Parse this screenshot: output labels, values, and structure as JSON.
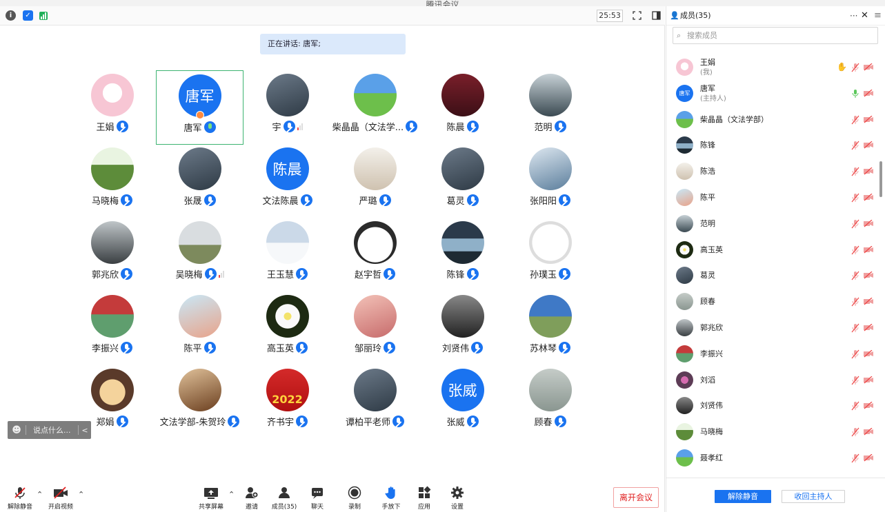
{
  "window": {
    "title": "腾讯会议"
  },
  "topbar": {
    "timer": "25:53",
    "icons": [
      "info-icon",
      "shield-icon",
      "signal-icon",
      "fullscreen-icon",
      "layout-icon"
    ]
  },
  "speaking": {
    "text": "正在讲话: 唐军;"
  },
  "grid": {
    "participants": [
      {
        "name": "王娟",
        "avatar": "anime-girl",
        "mic": "muted",
        "bars": 0
      },
      {
        "name": "唐军",
        "avatar_text": "唐军",
        "mic": "active",
        "bars": 0,
        "active": true
      },
      {
        "name": "宇",
        "avatar": "photo",
        "mic": "muted",
        "bars": 3
      },
      {
        "name": "柴晶晶（文法学...",
        "avatar": "landscape",
        "mic": "muted",
        "bars": 0
      },
      {
        "name": "陈晨",
        "avatar": "rabbits",
        "mic": "muted",
        "bars": 0
      },
      {
        "name": "范明",
        "avatar": "swan",
        "mic": "muted",
        "bars": 0
      },
      {
        "name": "马晓梅",
        "avatar": "sprout",
        "mic": "muted",
        "bars": 0
      },
      {
        "name": "张晟",
        "avatar": "photo",
        "mic": "muted",
        "bars": 0
      },
      {
        "name": "文法陈晨",
        "avatar_text": "陈晨",
        "mic": "muted",
        "bars": 0
      },
      {
        "name": "严璐",
        "avatar": "cartoon",
        "mic": "muted",
        "bars": 0
      },
      {
        "name": "葛灵",
        "avatar": "photo",
        "mic": "muted",
        "bars": 0
      },
      {
        "name": "张阳阳",
        "avatar": "sky",
        "mic": "muted",
        "bars": 0
      },
      {
        "name": "郭兆欣",
        "avatar": "dark-figure",
        "mic": "muted",
        "bars": 0
      },
      {
        "name": "吴晓梅",
        "avatar": "windmill",
        "mic": "muted",
        "bars": 3
      },
      {
        "name": "王玉慧",
        "avatar": "snow",
        "mic": "muted",
        "bars": 0
      },
      {
        "name": "赵宇哲",
        "avatar": "dog",
        "mic": "muted",
        "bars": 0
      },
      {
        "name": "陈锋",
        "avatar": "lake",
        "mic": "muted",
        "bars": 0
      },
      {
        "name": "孙璞玉",
        "avatar": "sketch",
        "mic": "muted",
        "bars": 0
      },
      {
        "name": "李振兴",
        "avatar": "court",
        "mic": "muted",
        "bars": 0
      },
      {
        "name": "陈平",
        "avatar": "dancer",
        "mic": "muted",
        "bars": 0
      },
      {
        "name": "高玉英",
        "avatar": "daisy",
        "mic": "muted",
        "bars": 0
      },
      {
        "name": "邹丽玲",
        "avatar": "woman",
        "mic": "muted",
        "bars": 0
      },
      {
        "name": "刘贤伟",
        "avatar": "bw-photo",
        "mic": "muted",
        "bars": 0
      },
      {
        "name": "苏林琴",
        "avatar": "sky-tree",
        "mic": "muted",
        "bars": 0
      },
      {
        "name": "郑娟",
        "avatar": "cartoon-girl",
        "mic": "muted",
        "bars": 0
      },
      {
        "name": "文法学部-朱贺玲",
        "avatar": "dog-fur",
        "mic": "muted",
        "bars": 0
      },
      {
        "name": "齐书宇",
        "avatar": "tiger-2022",
        "avatar_label": "2022",
        "mic": "muted",
        "bars": 0
      },
      {
        "name": "谭柏平老师",
        "avatar": "photo",
        "mic": "muted",
        "bars": 0
      },
      {
        "name": "张威",
        "avatar_text": "张威",
        "mic": "muted",
        "bars": 0
      },
      {
        "name": "顾春",
        "avatar": "woman-gray",
        "mic": "muted",
        "bars": 0
      }
    ]
  },
  "chat": {
    "placeholder": "说点什么...",
    "arrow": "<"
  },
  "bottombar": {
    "unmute": "解除静音",
    "video": "开启视频",
    "share": "共享屏幕",
    "invite": "邀请",
    "members": "成员(35)",
    "chat": "聊天",
    "record": "录制",
    "hand": "手放下",
    "apps": "应用",
    "settings": "设置",
    "leave": "离开会议"
  },
  "panel": {
    "title": "成员(35)",
    "more": "···",
    "close": "✕",
    "search_placeholder": "搜索成员",
    "members": [
      {
        "name": "王娟",
        "sub": "(我)",
        "av": "anime-girl",
        "hand": true,
        "mic": "muted-red"
      },
      {
        "name": "唐军",
        "sub": "(主持人)",
        "av_text": "唐军",
        "mic": "green"
      },
      {
        "name": "柴晶晶（文法学部）",
        "av": "landscape",
        "mic": "muted-red"
      },
      {
        "name": "陈锋",
        "av": "lake",
        "mic": "muted-red"
      },
      {
        "name": "陈浩",
        "av": "cartoon",
        "mic": "muted-red"
      },
      {
        "name": "陈平",
        "av": "dancer",
        "mic": "muted-red"
      },
      {
        "name": "范明",
        "av": "swan",
        "mic": "muted-red"
      },
      {
        "name": "高玉英",
        "av": "daisy",
        "mic": "muted-red"
      },
      {
        "name": "葛灵",
        "av": "photo",
        "mic": "muted-red"
      },
      {
        "name": "顾春",
        "av": "woman-gray",
        "mic": "muted-red"
      },
      {
        "name": "郭兆欣",
        "av": "dark-figure",
        "mic": "muted-red"
      },
      {
        "name": "李振兴",
        "av": "court",
        "mic": "muted-red"
      },
      {
        "name": "刘滔",
        "av": "flowers",
        "mic": "muted-red"
      },
      {
        "name": "刘贤伟",
        "av": "bw-photo",
        "mic": "muted-red"
      },
      {
        "name": "马晓梅",
        "av": "sprout",
        "mic": "muted-red"
      },
      {
        "name": "聂孝红",
        "av": "landscape",
        "mic": "muted-red"
      }
    ],
    "unmute_all": "解除静音",
    "reclaim_host": "收回主持人"
  },
  "colors": {
    "accent": "#1a73f0",
    "active_border": "#3cb371",
    "leave_red": "#e02020",
    "muted_red": "#e44"
  }
}
